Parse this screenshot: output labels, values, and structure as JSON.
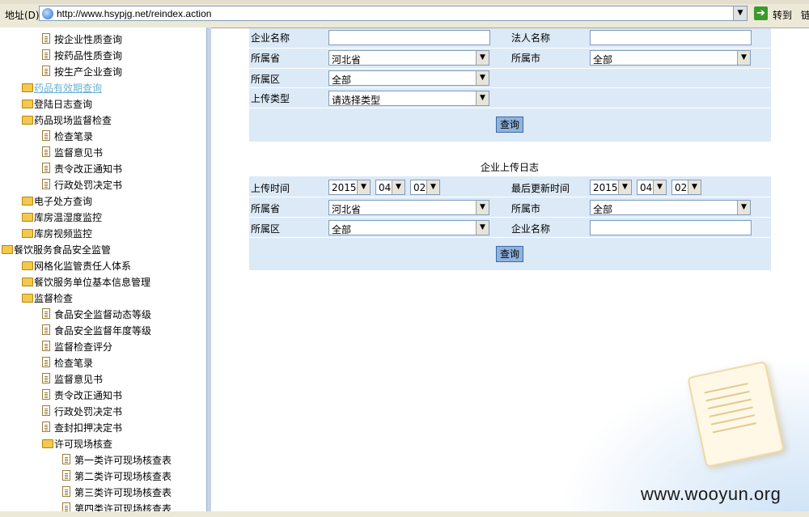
{
  "address_bar": {
    "label": "地址(D)",
    "url": "http://www.hsypjg.net/reindex.action",
    "go_label": "转到",
    "links_label": "链"
  },
  "tree": [
    {
      "label": "按企业性质查询",
      "type": "doc",
      "level": 2
    },
    {
      "label": "按药品性质查询",
      "type": "doc",
      "level": 2
    },
    {
      "label": "按生产企业查询",
      "type": "doc",
      "level": 2
    },
    {
      "label": "药品有效期查询",
      "type": "folder",
      "level": 1,
      "active": true
    },
    {
      "label": "登陆日志查询",
      "type": "folder",
      "level": 1
    },
    {
      "label": "药品现场监督检查",
      "type": "folder",
      "level": 1
    },
    {
      "label": "检查笔录",
      "type": "doc",
      "level": 2
    },
    {
      "label": "监督意见书",
      "type": "doc",
      "level": 2
    },
    {
      "label": "责令改正通知书",
      "type": "doc",
      "level": 2
    },
    {
      "label": "行政处罚决定书",
      "type": "doc",
      "level": 2
    },
    {
      "label": "电子处方查询",
      "type": "folder",
      "level": 1
    },
    {
      "label": "库房温湿度监控",
      "type": "folder",
      "level": 1
    },
    {
      "label": "库房视频监控",
      "type": "folder",
      "level": 1
    },
    {
      "label": "餐饮服务食品安全监管",
      "type": "folder",
      "level": 0
    },
    {
      "label": "网格化监管责任人体系",
      "type": "folder",
      "level": 1
    },
    {
      "label": "餐饮服务单位基本信息管理",
      "type": "folder",
      "level": 1
    },
    {
      "label": "监督检查",
      "type": "folder",
      "level": 1
    },
    {
      "label": "食品安全监督动态等级",
      "type": "doc",
      "level": 2
    },
    {
      "label": "食品安全监督年度等级",
      "type": "doc",
      "level": 2
    },
    {
      "label": "监督检查评分",
      "type": "doc",
      "level": 2
    },
    {
      "label": "检查笔录",
      "type": "doc",
      "level": 2
    },
    {
      "label": "监督意见书",
      "type": "doc",
      "level": 2
    },
    {
      "label": "责令改正通知书",
      "type": "doc",
      "level": 2
    },
    {
      "label": "行政处罚决定书",
      "type": "doc",
      "level": 2
    },
    {
      "label": "查封扣押决定书",
      "type": "doc",
      "level": 2
    },
    {
      "label": "许可现场核查",
      "type": "folder",
      "level": 2
    },
    {
      "label": "第一类许可现场核查表",
      "type": "doc",
      "level": 3
    },
    {
      "label": "第二类许可现场核查表",
      "type": "doc",
      "level": 3
    },
    {
      "label": "第三类许可现场核查表",
      "type": "doc",
      "level": 3
    },
    {
      "label": "第四类许可现场核查表",
      "type": "doc",
      "level": 3
    }
  ],
  "form1": {
    "company_label": "企业名称",
    "legal_label": "法人名称",
    "province_label": "所属省",
    "province_value": "河北省",
    "city_label": "所属市",
    "city_value": "全部",
    "district_label": "所属区",
    "district_value": "全部",
    "upload_type_label": "上传类型",
    "upload_type_value": "请选择类型",
    "query_label": "查询"
  },
  "form2": {
    "title": "企业上传日志",
    "upload_time_label": "上传时间",
    "upload_year": "2015",
    "upload_month": "04",
    "upload_day": "02",
    "last_update_label": "最后更新时间",
    "update_year": "2015",
    "update_month": "04",
    "update_day": "02",
    "province_label": "所属省",
    "province_value": "河北省",
    "city_label": "所属市",
    "city_value": "全部",
    "district_label": "所属区",
    "district_value": "全部",
    "company_label": "企业名称",
    "query_label": "查询"
  },
  "watermark": {
    "text": "www.wooyun.org"
  }
}
